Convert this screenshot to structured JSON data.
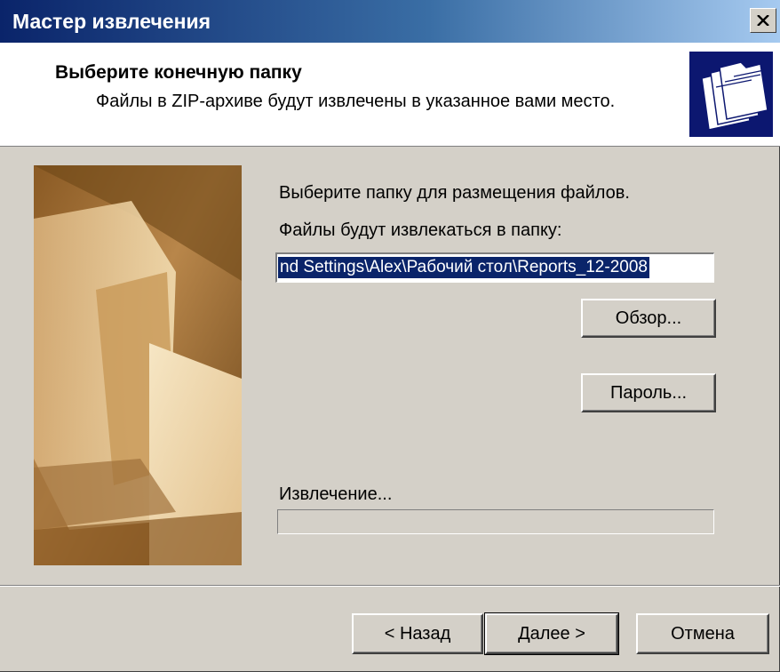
{
  "window": {
    "title": "Мастер извлечения",
    "close_glyph": "✕"
  },
  "header": {
    "title": "Выберите конечную папку",
    "subtitle": "Файлы в ZIP-архиве будут извлечены в указанное вами место.",
    "icon": "folders-icon"
  },
  "side_image": {
    "icon": "folder-photo-illustration",
    "colors": {
      "dark": "#5a3a14",
      "mid": "#a87a40",
      "light": "#e8cc98",
      "paper": "#f4e4c0"
    }
  },
  "main": {
    "instruction": "Выберите папку для размещения файлов.",
    "destination_label": "Файлы будут извлекаться в папку:",
    "destination_value": "nd Settings\\Alex\\Рабочий стол\\Reports_12-2008",
    "browse_label": "Обзор...",
    "password_label": "Пароль...",
    "extracting_label": "Извлечение...",
    "progress": 0
  },
  "footer": {
    "back_label": "< Назад",
    "next_label": "Далее >",
    "cancel_label": "Отмена"
  },
  "colors": {
    "dialog_face": "#d4d0c8",
    "title_start": "#0a246a",
    "title_end": "#a6caf0",
    "selection": "#0a246a",
    "header_icon_bg": "#0c1770"
  }
}
